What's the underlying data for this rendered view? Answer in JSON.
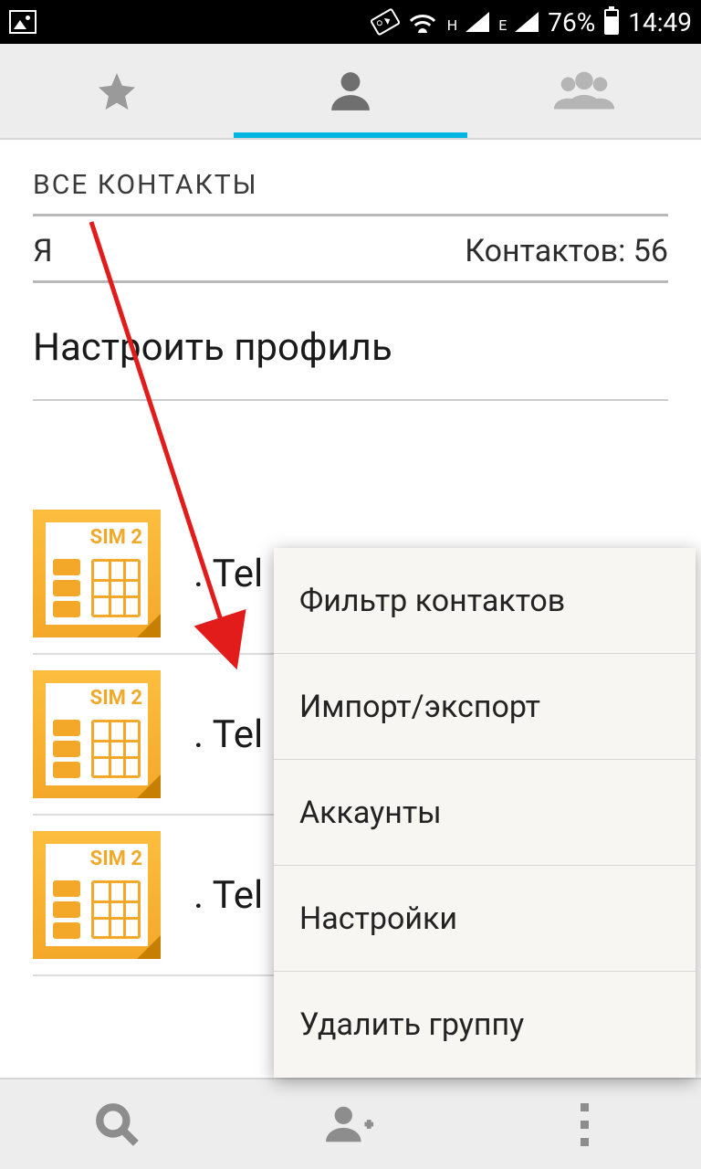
{
  "status": {
    "sig1_net": "H",
    "sig2_net": "E",
    "battery": "76%",
    "time": "14:49"
  },
  "header": {
    "section": "ВСЕ КОНТАКТЫ",
    "me_label": "Я",
    "count_label": "Контактов: 56",
    "setup": "Настроить профиль"
  },
  "sim": {
    "label": "SIM 2"
  },
  "rows": [
    {
      "text": ". Tel"
    },
    {
      "text": ". Tel"
    },
    {
      "text": ". Tel"
    }
  ],
  "menu": {
    "items": [
      "Фильтр контактов",
      "Импорт/экспорт",
      "Аккаунты",
      "Настройки",
      "Удалить группу"
    ]
  }
}
